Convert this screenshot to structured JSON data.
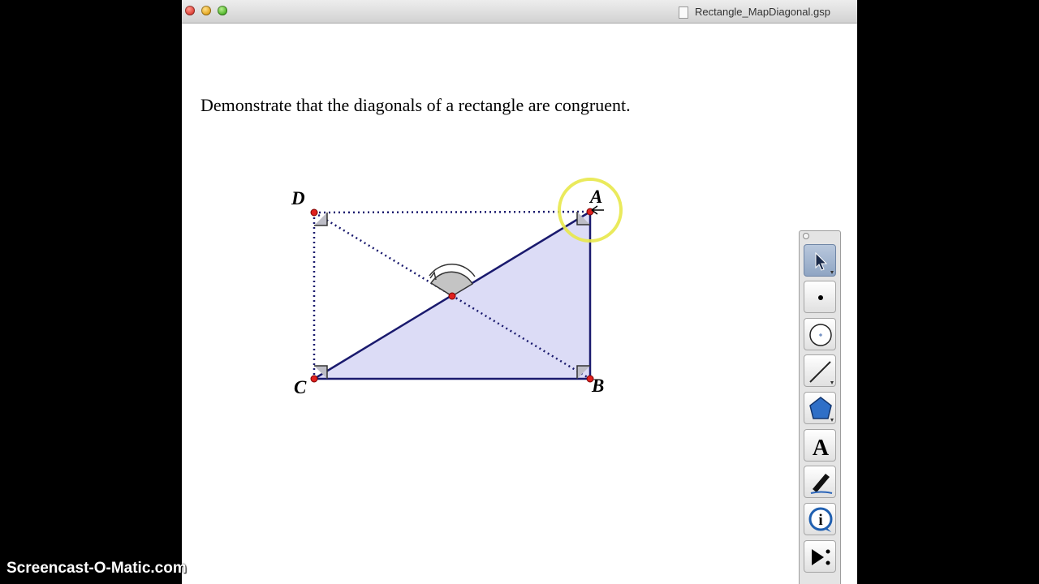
{
  "window": {
    "title": "Rectangle_MapDiagonal.gsp"
  },
  "prompt": "Demonstrate that the diagonals of a rectangle are congruent.",
  "sketch": {
    "points": {
      "A": "A",
      "B": "B",
      "C": "C",
      "D": "D"
    },
    "colors": {
      "fill": "#dcdcf6",
      "stroke": "#1a1a6e",
      "point": "#e0201e",
      "highlight": "#e8e84a"
    }
  },
  "toolbox": {
    "tools": [
      {
        "name": "arrow-select-tool",
        "icon": "arrow-icon",
        "active": true
      },
      {
        "name": "point-tool",
        "icon": "point-icon"
      },
      {
        "name": "compass-tool",
        "icon": "circle-icon"
      },
      {
        "name": "straightedge-tool",
        "icon": "segment-icon"
      },
      {
        "name": "polygon-tool",
        "icon": "pentagon-icon"
      },
      {
        "name": "text-tool",
        "icon": "text-A-icon",
        "label": "A"
      },
      {
        "name": "marker-tool",
        "icon": "marker-icon"
      },
      {
        "name": "information-tool",
        "icon": "info-icon",
        "label": "i"
      },
      {
        "name": "custom-tool",
        "icon": "play-more-icon"
      }
    ]
  },
  "watermark": "Screencast-O-Matic.com"
}
